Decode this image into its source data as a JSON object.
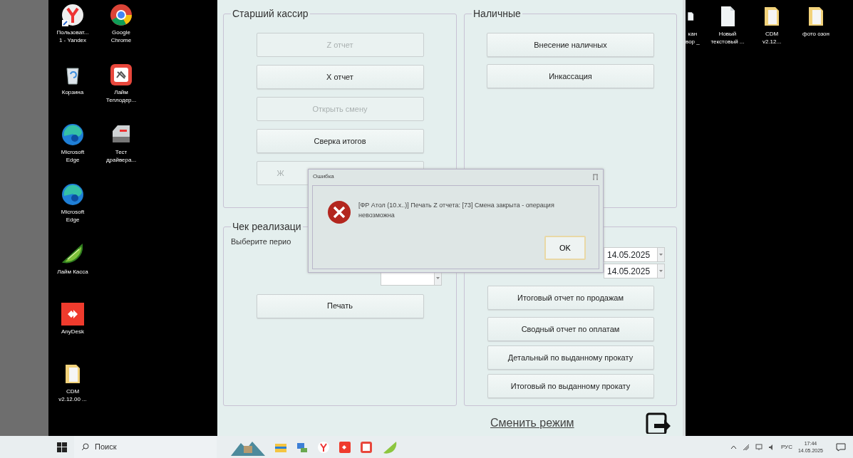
{
  "desktop_left": [
    {
      "label": "Пользоват...\n1 - Yandex"
    },
    {
      "label": "Корзина"
    },
    {
      "label": "Microsoft\nEdge"
    },
    {
      "label": "Microsoft\nEdge"
    },
    {
      "label": "Лайм Касса"
    },
    {
      "label": "AnyDesk"
    },
    {
      "label": "CDM\nv2.12.00 ..."
    },
    {
      "label": "Google\nChrome"
    },
    {
      "label": "Лайм\nТеплодер..."
    },
    {
      "label": "Тест\nдрайвера..."
    }
  ],
  "app": {
    "senior_cashier": {
      "title": "Старший кассир",
      "buttons": [
        {
          "label": "Z отчет",
          "disabled": true
        },
        {
          "label": "X отчет",
          "disabled": false
        },
        {
          "label": "Открыть смену",
          "disabled": true
        },
        {
          "label": "Сверка итогов",
          "disabled": false
        },
        {
          "label": "Ж",
          "disabled": true
        }
      ]
    },
    "cash": {
      "title": "Наличные",
      "buttons": [
        {
          "label": "Внесение наличных"
        },
        {
          "label": "Инкассация"
        }
      ]
    },
    "receipt": {
      "title": "Чек реализаци",
      "period_label": "Выберите перио",
      "print_button": "Печать"
    },
    "reports": {
      "date_from": "14.05.2025",
      "date_to": "14.05.2025",
      "buttons": [
        {
          "label": "Итоговый отчет по продажам"
        },
        {
          "label": "Сводный отчет по оплатам"
        },
        {
          "label": "Детальный по выданному прокату"
        },
        {
          "label": "Итоговый по выданному прокату"
        }
      ]
    },
    "switch_mode_link": "Сменить режим"
  },
  "desktop_right": [
    {
      "label": "кан\nвор _"
    },
    {
      "label": "Новый\nтекстовый ..."
    },
    {
      "label": "CDM\nv2.12..."
    },
    {
      "label": "фото озон"
    }
  ],
  "dialog": {
    "title": "Ошибка",
    "message": "[ФР Атол (10.х..)] Печать Z отчета: [73] Смена закрыта - операция невозможна",
    "ok_button": "OK"
  },
  "taskbar": {
    "search_placeholder": "Поиск",
    "language": "РУС",
    "time": "17:44",
    "date": "14.05.2025"
  }
}
